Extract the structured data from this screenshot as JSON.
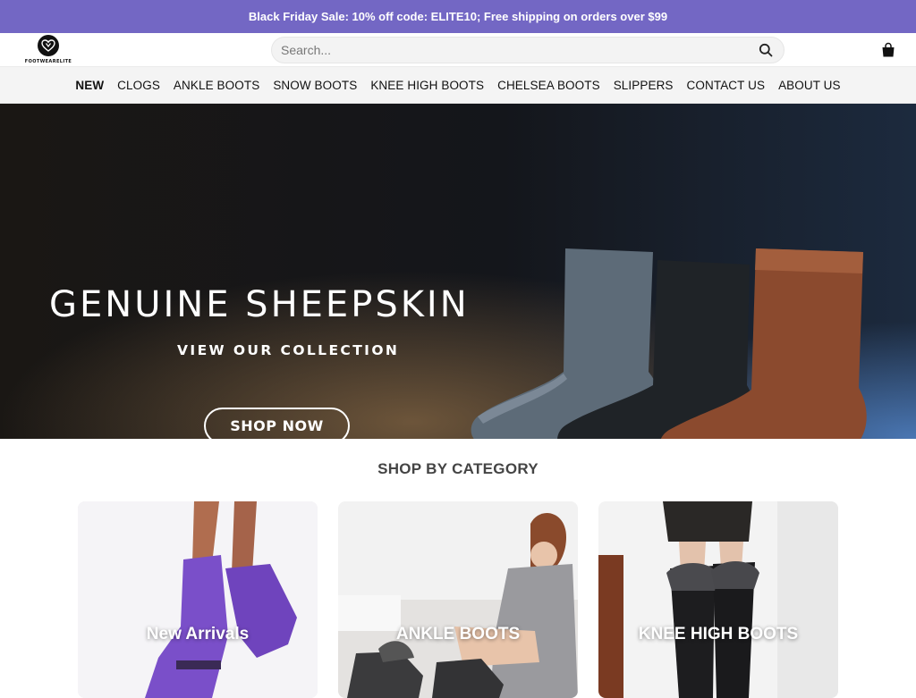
{
  "promo": {
    "text": "Black Friday Sale: 10% off code: ELITE10; Free shipping on orders over $99"
  },
  "header": {
    "logo_text": "FOOTWEARELITE",
    "search_placeholder": "Search...",
    "search_icon": "search-icon",
    "cart_icon": "shopping-bag-icon"
  },
  "nav": {
    "items": [
      {
        "label": "NEW"
      },
      {
        "label": "CLOGS"
      },
      {
        "label": "ANKLE BOOTS"
      },
      {
        "label": "SNOW BOOTS"
      },
      {
        "label": "KNEE HIGH BOOTS"
      },
      {
        "label": "CHELSEA BOOTS"
      },
      {
        "label": "SLIPPERS"
      },
      {
        "label": "CONTACT US"
      },
      {
        "label": "ABOUT US"
      }
    ]
  },
  "hero": {
    "title": "GENUINE SHEEPSKIN",
    "subtitle": "VIEW OUR COLLECTION",
    "button": "SHOP NOW"
  },
  "category": {
    "title": "SHOP BY CATEGORY",
    "cards": [
      {
        "label": "New Arrivals"
      },
      {
        "label": "ANKLE BOOTS"
      },
      {
        "label": "KNEE HIGH BOOTS"
      }
    ]
  },
  "colors": {
    "promo_bg": "#7367c4",
    "nav_bg": "#f4f4f4",
    "purple_boot": "#7a4fc9",
    "brown_boot": "#8b4a2e"
  }
}
